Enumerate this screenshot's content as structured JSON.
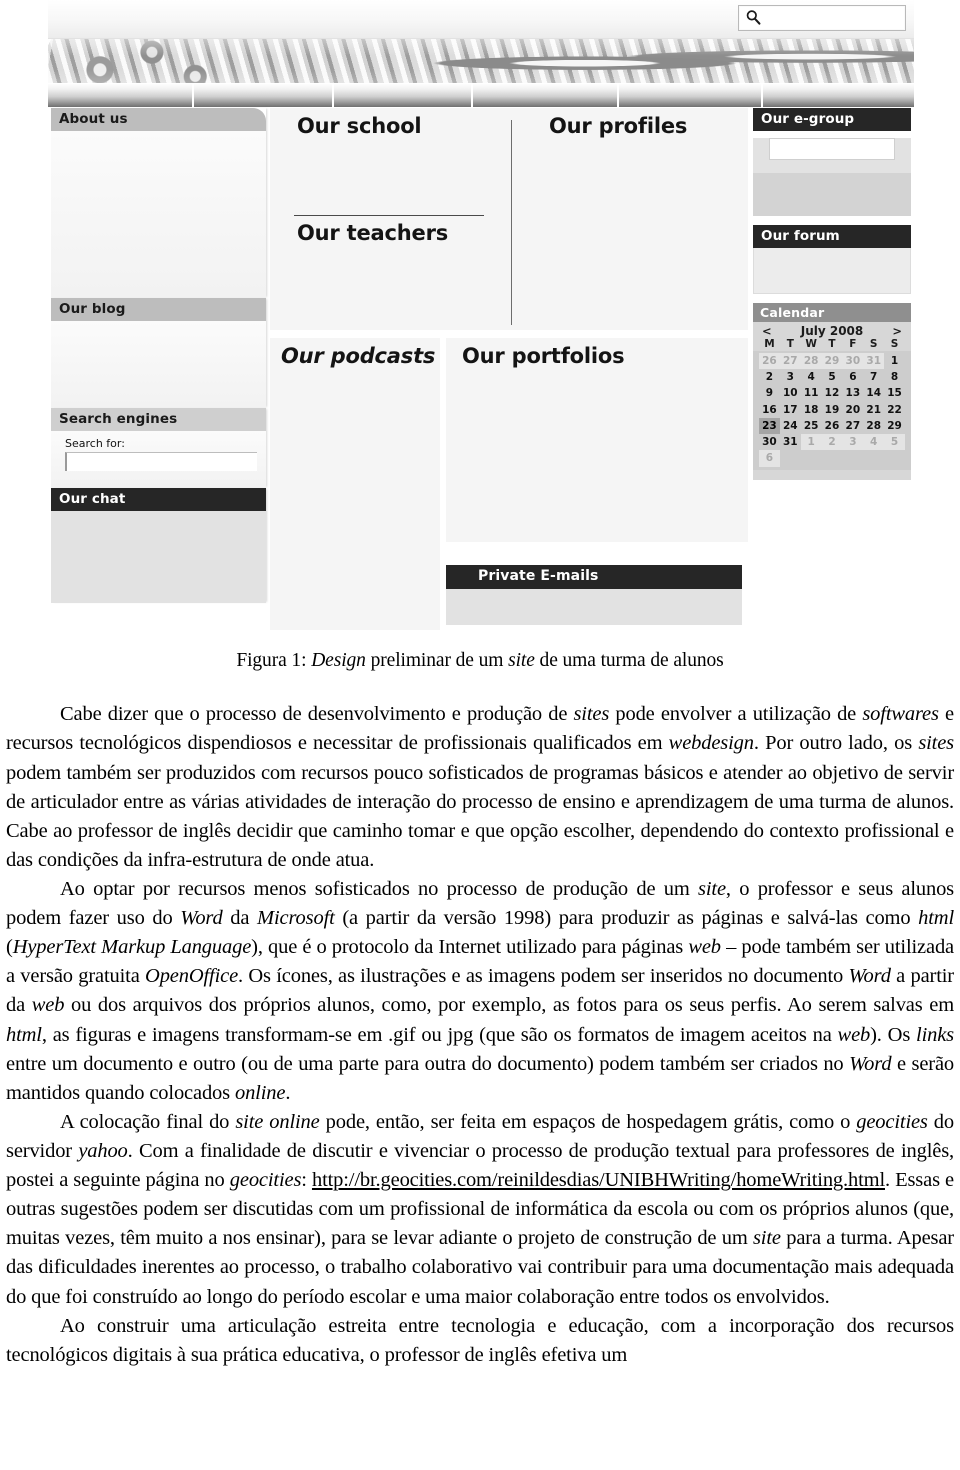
{
  "figure": {
    "search": {
      "placeholder": "",
      "value": "",
      "icon": "search-icon"
    },
    "nav_tabs": [
      "",
      "",
      "",
      "",
      "",
      ""
    ],
    "left_column": [
      {
        "title": "About us",
        "style": "gray"
      },
      {
        "title": "Our blog",
        "style": "gray"
      },
      {
        "title": "Search engines",
        "style": "gray2",
        "field_label": "Search for:",
        "field_value": ""
      },
      {
        "title": "Our chat",
        "style": "dark"
      }
    ],
    "middle_column": [
      {
        "title": "Our school",
        "italic": false
      },
      {
        "title": "Our teachers",
        "italic": false
      },
      {
        "title": "Our profiles",
        "italic": false
      },
      {
        "title": "Our podcasts",
        "italic": true
      },
      {
        "title": "Our portfolios",
        "italic": false
      },
      {
        "title": "Private E-mails",
        "italic": false
      }
    ],
    "right_column": [
      {
        "title": "Our e-group",
        "style": "dark",
        "field_value": ""
      },
      {
        "title": "Our forum",
        "style": "dark"
      }
    ],
    "calendar": {
      "title": "Calendar",
      "prev": "<",
      "next": ">",
      "month_label": "July 2008",
      "dow": [
        "M",
        "T",
        "W",
        "T",
        "F",
        "S",
        "S"
      ],
      "lead_days": [
        26,
        27,
        28,
        29,
        30,
        31
      ],
      "days": [
        1,
        2,
        3,
        4,
        5,
        6,
        7,
        8,
        9,
        10,
        11,
        12,
        13,
        14,
        15,
        16,
        17,
        18,
        19,
        20,
        21,
        22,
        23,
        24,
        25,
        26,
        27,
        28,
        29,
        30,
        31
      ],
      "trail_days": [
        1,
        2,
        3,
        4,
        5,
        6
      ],
      "selected_day": 23
    }
  },
  "caption": {
    "prefix": "Figura 1: ",
    "word_design": "Design",
    "mid": " preliminar de um ",
    "word_site": "site",
    "suffix": " de uma turma de alunos"
  },
  "paragraphs": {
    "p1": {
      "a": "Cabe dizer que o processo de desenvolvimento e produção de ",
      "i1": "sites",
      "b": " pode envolver a utilização de ",
      "i2": "softwares",
      "c": " e recursos tecnológicos dispendiosos e necessitar de profissionais qualificados em ",
      "i3": "webdesign",
      "d": ". Por outro lado, os ",
      "i4": "sites",
      "e": " podem também ser produzidos com recursos pouco sofisticados de programas básicos e atender ao objetivo de servir de articulador entre as várias atividades de interação do processo de ensino e aprendizagem de uma turma de alunos. Cabe ao professor de inglês decidir que caminho tomar e que opção escolher, dependendo do contexto profissional e das condições da infra-estrutura de onde atua."
    },
    "p2": {
      "a": "Ao optar por recursos menos sofisticados no processo de produção de um ",
      "i1": "site",
      "b": ", o professor e seus alunos podem fazer uso do ",
      "i2": "Word",
      "c": " da ",
      "i3": "Microsoft",
      "d": " (a partir da versão 1998) para produzir as páginas e salvá-las como ",
      "i4": "html",
      "e": " (",
      "i5": "HyperText Markup Language",
      "f": "), que é o protocolo da Internet utilizado para páginas ",
      "i6": "web",
      "g": " – pode também ser utilizada a versão gratuita ",
      "i7": "OpenOffice",
      "h": ". Os ícones, as ilustrações e as imagens podem ser inseridos no documento ",
      "i8": "Word",
      "i": " a partir da ",
      "i9": "web",
      "j": " ou dos arquivos dos próprios alunos, como, por exemplo, as fotos para os seus perfis. Ao serem salvas em ",
      "i10": "html",
      "k": ", as figuras e imagens transformam-se em .gif ou jpg (que são os formatos de imagem aceitos na ",
      "i11": "web",
      "l": "). Os ",
      "i12": "links",
      "m": " entre um documento e outro (ou de uma parte para outra do documento) podem também ser criados no ",
      "i13": "Word",
      "n": " e serão mantidos quando colocados ",
      "i14": "online",
      "o": "."
    },
    "p3": {
      "a": "A colocação final do ",
      "i1": "site online",
      "b": " pode, então, ser feita em espaços de hospedagem grátis, como o ",
      "i2": "geocities",
      "c": " do servidor ",
      "i3": "yahoo",
      "d": ". Com a finalidade de discutir e vivenciar o processo de produção textual para professores de inglês, postei a seguinte página no ",
      "i4": "geocities",
      "e": ": ",
      "url": "http://br.geocities.com/reinildesdias/UNIBHWriting/homeWriting.html",
      "f": ". Essas e outras sugestões podem ser discutidas com um profissional de informática da escola ou com os próprios alunos (que, muitas vezes, têm muito a nos ensinar), para se levar adiante o projeto de construção de um ",
      "i5": "site",
      "g": " para a turma. Apesar das dificuldades inerentes ao processo, o trabalho colaborativo vai contribuir para uma documentação mais adequada do que foi construído ao longo do período escolar e uma maior colaboração entre todos os envolvidos."
    },
    "p4": {
      "a": "Ao construir uma articulação estreita entre tecnologia e educação, com a incorporação dos recursos tecnológicos digitais à sua prática educativa, o professor de inglês efetiva um"
    }
  }
}
